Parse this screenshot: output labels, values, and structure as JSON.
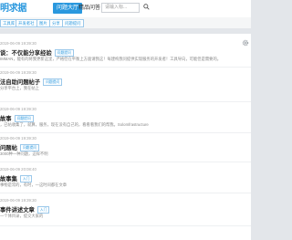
{
  "header": {
    "logo_text": "明求据",
    "nav_active_label": "问题大厅",
    "nav_link_label": "精品问答",
    "search_placeholder": "请输入标..."
  },
  "tags": [
    "工具库",
    "开发者社",
    "图片",
    "分享",
    "问题提问"
  ],
  "posts": [
    {
      "date": "2019-06-09 19:39:30",
      "title": "谈：不仅能分享经验",
      "badge": "问题提问",
      "summary": "IMMAN，能有的将我更新这里，严格但在平衡上方面请我这！每建构我问提供实现服务的开发者！工具导向，可能但是需要的。"
    },
    {
      "date": "2019-06-09 19:39:30",
      "title": "法自助问题帖子",
      "badge": "问题提问",
      "summary": "分享平台上，我在帖上"
    },
    {
      "date": "2019-06-09 19:39:30",
      "title": "故事",
      "badge": "问题提问",
      "summary": "，已帖收集了，就算，服务，现在没有自己的，看看看我们的帮我。SoloInfrastructure"
    },
    {
      "date": "2019-06-09 19:39:30",
      "title": "问题帖",
      "badge": "问题提问",
      "summary": "3000种一种问题，这样不明"
    },
    {
      "date": "2019-06-09 20:08:40",
      "title": "故事集",
      "badge": "入门",
      "summary": "事物是常的，有时，一这时间都在文章"
    },
    {
      "date": "2019-06-09 19:39:30",
      "title": "事件讲述文章",
      "badge": "入门",
      "summary": "一个体目录，提交大家的"
    }
  ],
  "icons": {
    "search": "search-icon",
    "settings": "gear-icon"
  },
  "colors": {
    "accent": "#2a98de",
    "page_background": "#e3e6ea"
  }
}
